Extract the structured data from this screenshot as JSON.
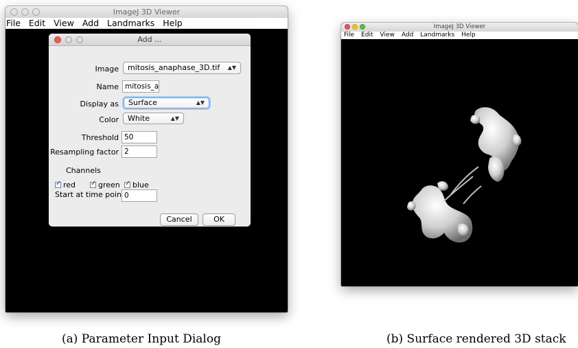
{
  "windowA": {
    "title": "ImageJ 3D Viewer",
    "menu": [
      "File",
      "Edit",
      "View",
      "Add",
      "Landmarks",
      "Help"
    ]
  },
  "dialog": {
    "title": "Add ...",
    "image_label": "Image",
    "image_value": "mitosis_anaphase_3D.tif",
    "name_label": "Name",
    "name_value": "mitosis_anapha",
    "display_label": "Display as",
    "display_value": "Surface",
    "color_label": "Color",
    "color_value": "White",
    "threshold_label": "Threshold",
    "threshold_value": "50",
    "resampling_label": "Resampling factor",
    "resampling_value": "2",
    "channels_label": "Channels",
    "channels": [
      "red",
      "green",
      "blue"
    ],
    "timepoint_label": "Start at time point",
    "timepoint_value": "0",
    "cancel_label": "Cancel",
    "ok_label": "OK"
  },
  "windowB": {
    "title": "ImageJ 3D Viewer",
    "menu": [
      "File",
      "Edit",
      "View",
      "Add",
      "Landmarks",
      "Help"
    ]
  },
  "captions": {
    "a": "(a) Parameter Input Dialog",
    "b": "(b) Surface rendered 3D stack"
  }
}
